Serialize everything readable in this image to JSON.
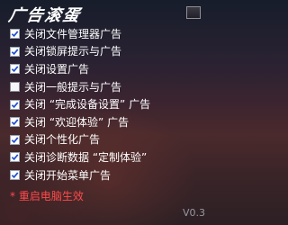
{
  "window": {
    "title": "广告滚蛋",
    "close_icon": "close-icon",
    "version": "V0.3"
  },
  "options": [
    {
      "label": "关闭文件管理器广告",
      "checked": true
    },
    {
      "label": "关闭锁屏提示与广告",
      "checked": true
    },
    {
      "label": "关闭设置广告",
      "checked": true
    },
    {
      "label": "关闭一般提示与广告",
      "checked": false
    },
    {
      "label": "关闭 “完成设备设置” 广告",
      "checked": true
    },
    {
      "label": "关闭 “欢迎体验” 广告",
      "checked": true
    },
    {
      "label": "关闭个性化广告",
      "checked": true
    },
    {
      "label": "关闭诊断数据 “定制体验”",
      "checked": true
    },
    {
      "label": "关闭开始菜单广告",
      "checked": true
    }
  ],
  "note": "* 重启电脑生效",
  "colors": {
    "note": "#ff4a4a",
    "check": "#1f4fd1",
    "version": "#9a97a0"
  }
}
